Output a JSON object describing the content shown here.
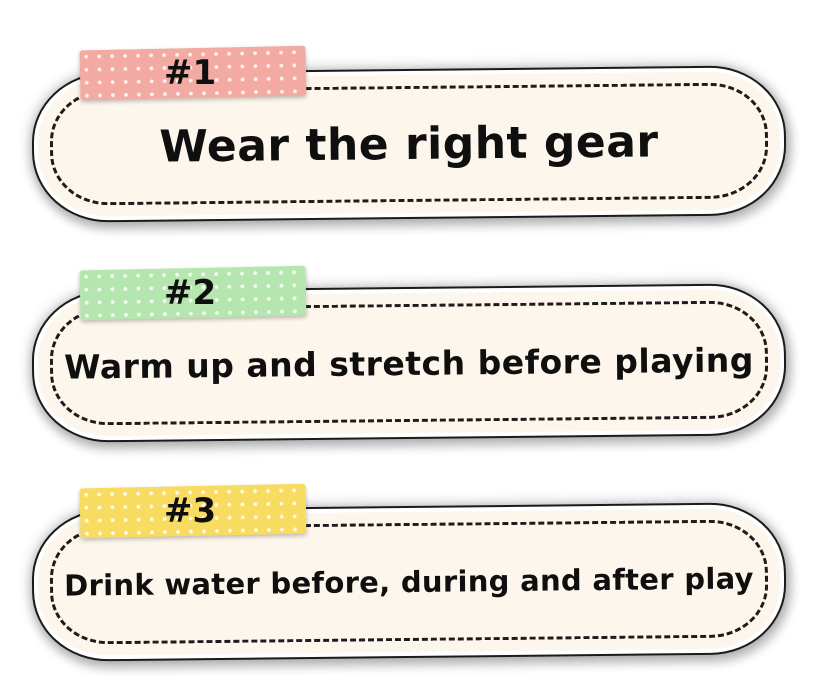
{
  "tips": [
    {
      "number": "#1",
      "text": "Wear the right gear",
      "tape_color": "#f3aaa2"
    },
    {
      "number": "#2",
      "text": "Warm up and stretch before playing",
      "tape_color": "#b6e6b0"
    },
    {
      "number": "#3",
      "text": "Drink water before, during and after play",
      "tape_color": "#f8dc62"
    }
  ],
  "colors": {
    "card_fill": "#fdf6ec",
    "outline": "#1b1b1b",
    "text": "#0f0f0f"
  }
}
